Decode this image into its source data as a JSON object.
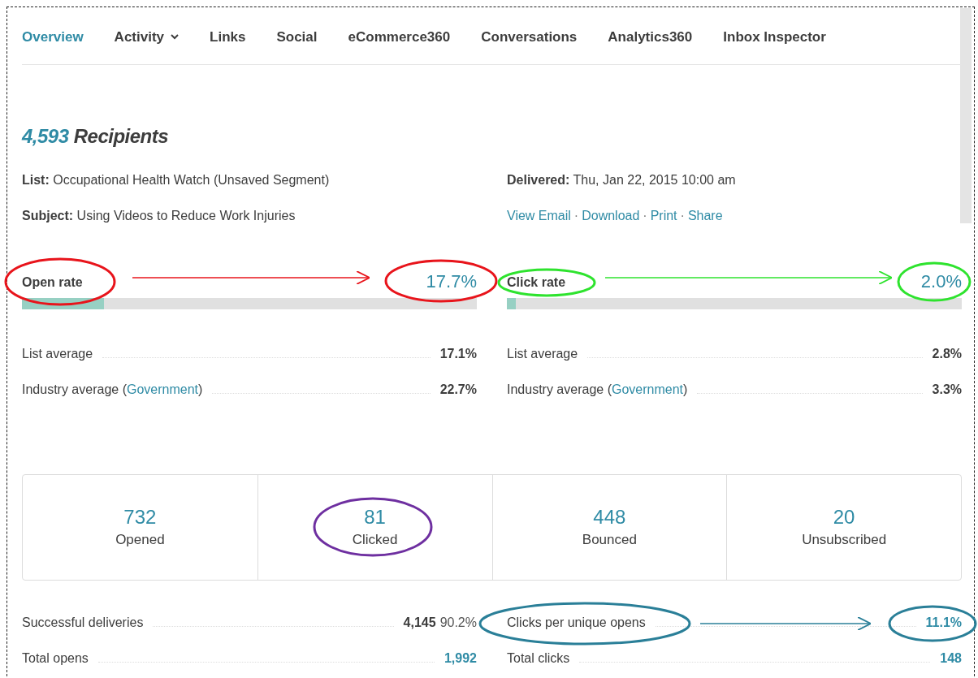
{
  "tabs": [
    {
      "label": "Overview",
      "selected": true,
      "dropdown": false
    },
    {
      "label": "Activity",
      "selected": false,
      "dropdown": true
    },
    {
      "label": "Links",
      "selected": false,
      "dropdown": false
    },
    {
      "label": "Social",
      "selected": false,
      "dropdown": false
    },
    {
      "label": "eCommerce360",
      "selected": false,
      "dropdown": false
    },
    {
      "label": "Conversations",
      "selected": false,
      "dropdown": false
    },
    {
      "label": "Analytics360",
      "selected": false,
      "dropdown": false
    },
    {
      "label": "Inbox Inspector",
      "selected": false,
      "dropdown": false
    }
  ],
  "recipients": {
    "count": "4,593",
    "label": "Recipients"
  },
  "details": [
    {
      "label": "List:",
      "value": "Occupational Health Watch (Unsaved Segment)"
    },
    {
      "label": "Delivered:",
      "value": "Thu, Jan 22, 2015 10:00 am"
    },
    {
      "label": "Subject:",
      "value": "Using Videos to Reduce Work Injuries"
    }
  ],
  "email_links": [
    "View Email",
    "Download",
    "Print",
    "Share"
  ],
  "link_separator": "·",
  "rates": [
    {
      "label": "Open rate",
      "value": "17.7%",
      "level": 0.18,
      "list_average_label": "List average",
      "list_average": "17.1%",
      "industry_label": "Industry average (",
      "industry_link": "Government",
      "industry_close": ")",
      "industry_average": "22.7%"
    },
    {
      "label": "Click rate",
      "value": "2.0%",
      "level": 0.02,
      "list_average_label": "List average",
      "list_average": "2.8%",
      "industry_label": "Industry average (",
      "industry_link": "Government",
      "industry_close": ")",
      "industry_average": "3.3%"
    }
  ],
  "stats": [
    {
      "value": "732",
      "label": "Opened"
    },
    {
      "value": "81",
      "label": "Clicked"
    },
    {
      "value": "448",
      "label": "Bounced"
    },
    {
      "value": "20",
      "label": "Unsubscribed"
    }
  ],
  "summary": [
    {
      "label": "Successful deliveries",
      "value": "4,145",
      "extra": "90.2%",
      "kind": "plain"
    },
    {
      "label": "Clicks per unique opens",
      "value": "11.1%",
      "kind": "link"
    },
    {
      "label": "Total opens",
      "value": "1,992",
      "kind": "link"
    },
    {
      "label": "Total clicks",
      "value": "148",
      "kind": "link"
    }
  ]
}
